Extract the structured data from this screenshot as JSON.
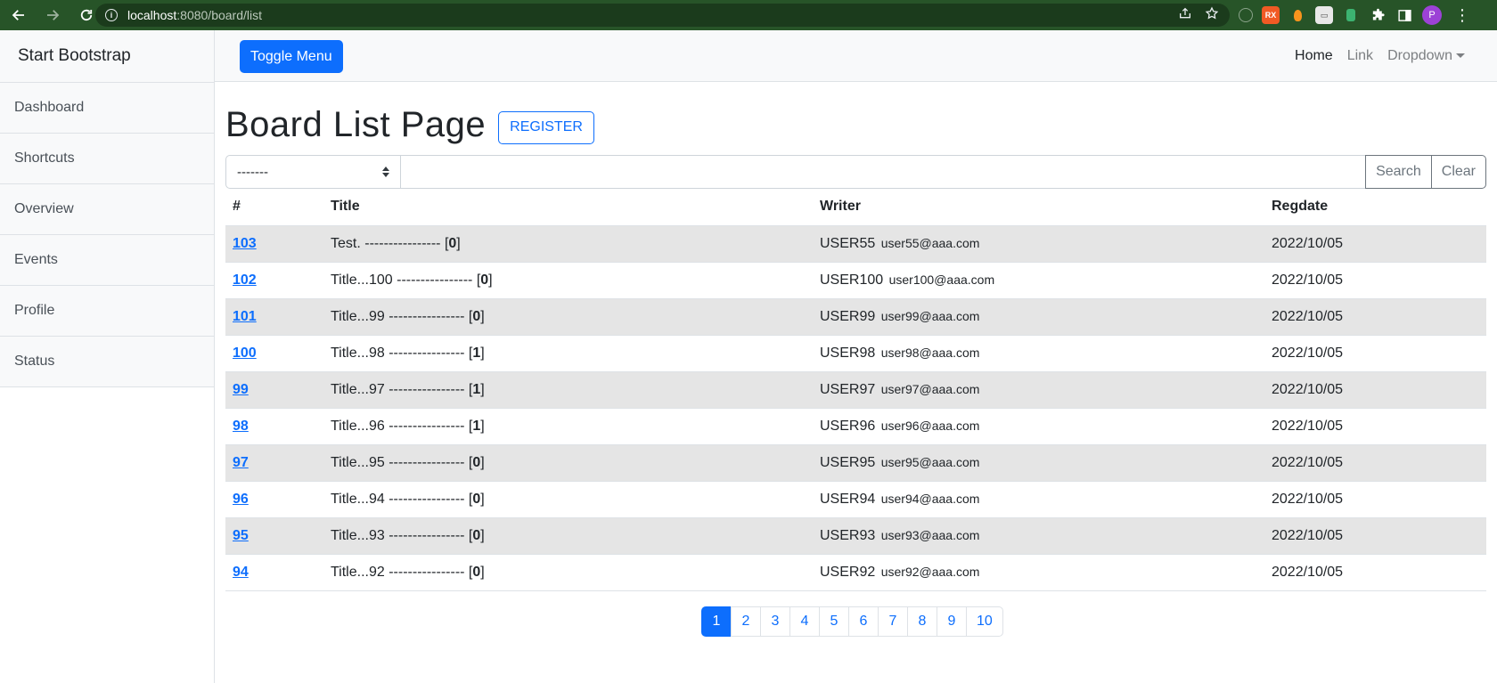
{
  "browser": {
    "url_host": "localhost",
    "url_path": ":8080/board/list",
    "avatar_letter": "P"
  },
  "sidebar": {
    "heading": "Start Bootstrap",
    "items": [
      {
        "label": "Dashboard"
      },
      {
        "label": "Shortcuts"
      },
      {
        "label": "Overview"
      },
      {
        "label": "Events"
      },
      {
        "label": "Profile"
      },
      {
        "label": "Status"
      }
    ]
  },
  "topnav": {
    "toggle_label": "Toggle Menu",
    "home_label": "Home",
    "link_label": "Link",
    "dropdown_label": "Dropdown"
  },
  "page": {
    "title": "Board List Page",
    "register_label": "REGISTER"
  },
  "search": {
    "select_value": "-------",
    "keyword_value": "",
    "search_label": "Search",
    "clear_label": "Clear"
  },
  "table": {
    "headers": {
      "num": "#",
      "title": "Title",
      "writer": "Writer",
      "regdate": "Regdate"
    },
    "rows": [
      {
        "bno": "103",
        "title": "Test.",
        "dashes": "----------------",
        "reply_count": "0",
        "writer": "USER55",
        "email": "user55@aaa.com",
        "regdate": "2022/10/05"
      },
      {
        "bno": "102",
        "title": "Title...100",
        "dashes": "----------------",
        "reply_count": "0",
        "writer": "USER100",
        "email": "user100@aaa.com",
        "regdate": "2022/10/05"
      },
      {
        "bno": "101",
        "title": "Title...99",
        "dashes": "----------------",
        "reply_count": "0",
        "writer": "USER99",
        "email": "user99@aaa.com",
        "regdate": "2022/10/05"
      },
      {
        "bno": "100",
        "title": "Title...98",
        "dashes": "----------------",
        "reply_count": "1",
        "writer": "USER98",
        "email": "user98@aaa.com",
        "regdate": "2022/10/05"
      },
      {
        "bno": "99",
        "title": "Title...97",
        "dashes": "----------------",
        "reply_count": "1",
        "writer": "USER97",
        "email": "user97@aaa.com",
        "regdate": "2022/10/05"
      },
      {
        "bno": "98",
        "title": "Title...96",
        "dashes": "----------------",
        "reply_count": "1",
        "writer": "USER96",
        "email": "user96@aaa.com",
        "regdate": "2022/10/05"
      },
      {
        "bno": "97",
        "title": "Title...95",
        "dashes": "----------------",
        "reply_count": "0",
        "writer": "USER95",
        "email": "user95@aaa.com",
        "regdate": "2022/10/05"
      },
      {
        "bno": "96",
        "title": "Title...94",
        "dashes": "----------------",
        "reply_count": "0",
        "writer": "USER94",
        "email": "user94@aaa.com",
        "regdate": "2022/10/05"
      },
      {
        "bno": "95",
        "title": "Title...93",
        "dashes": "----------------",
        "reply_count": "0",
        "writer": "USER93",
        "email": "user93@aaa.com",
        "regdate": "2022/10/05"
      },
      {
        "bno": "94",
        "title": "Title...92",
        "dashes": "----------------",
        "reply_count": "0",
        "writer": "USER92",
        "email": "user92@aaa.com",
        "regdate": "2022/10/05"
      }
    ]
  },
  "pagination": {
    "pages": [
      "1",
      "2",
      "3",
      "4",
      "5",
      "6",
      "7",
      "8",
      "9",
      "10"
    ],
    "active": "1"
  },
  "colors": {
    "primary": "#0d6efd",
    "chrome_bg": "#275428",
    "stripe": "#e5e5e5"
  }
}
